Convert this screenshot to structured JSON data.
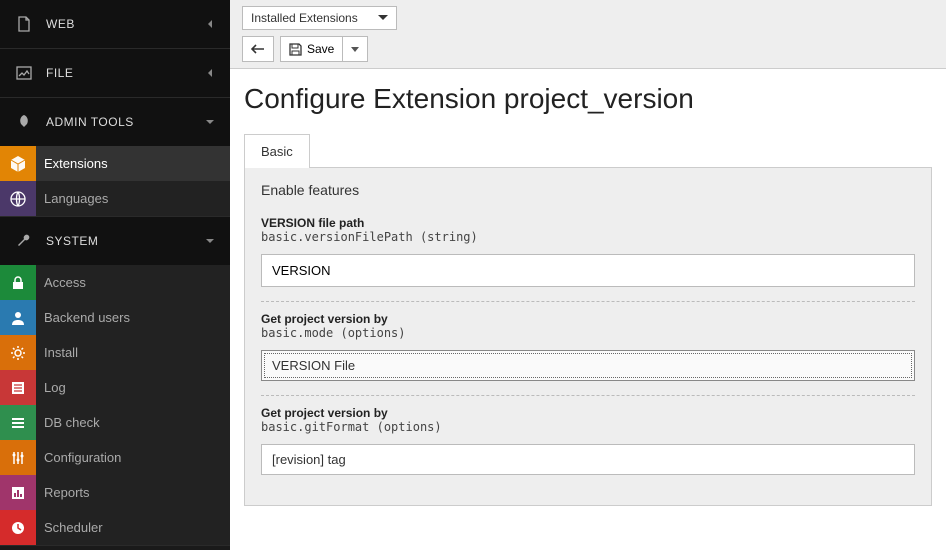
{
  "sidebar": {
    "groups": [
      {
        "label": "WEB",
        "expanded": false,
        "items": []
      },
      {
        "label": "FILE",
        "expanded": false,
        "items": []
      },
      {
        "label": "ADMIN TOOLS",
        "expanded": true,
        "items": [
          {
            "label": "Extensions",
            "icon": "box-icon",
            "color": "ic-orange",
            "active": true
          },
          {
            "label": "Languages",
            "icon": "globe-icon",
            "color": "ic-purple",
            "active": false
          }
        ]
      },
      {
        "label": "SYSTEM",
        "expanded": true,
        "items": [
          {
            "label": "Access",
            "icon": "lock-icon",
            "color": "ic-green",
            "active": false
          },
          {
            "label": "Backend users",
            "icon": "user-icon",
            "color": "ic-blue",
            "active": false
          },
          {
            "label": "Install",
            "icon": "gear-icon",
            "color": "ic-orange2",
            "active": false
          },
          {
            "label": "Log",
            "icon": "list-icon",
            "color": "ic-red",
            "active": false
          },
          {
            "label": "DB check",
            "icon": "bars-icon",
            "color": "ic-green2",
            "active": false
          },
          {
            "label": "Configuration",
            "icon": "sliders-icon",
            "color": "ic-orange2",
            "active": false
          },
          {
            "label": "Reports",
            "icon": "report-icon",
            "color": "ic-pink",
            "active": false
          },
          {
            "label": "Scheduler",
            "icon": "clock-icon",
            "color": "ic-red2",
            "active": false
          }
        ]
      }
    ]
  },
  "toolbar": {
    "dropdown_label": "Installed Extensions",
    "back_label": "",
    "save_label": "Save"
  },
  "page": {
    "title": "Configure Extension project_version",
    "tabs": [
      {
        "label": "Basic",
        "active": true
      }
    ],
    "section_heading": "Enable features",
    "fields": [
      {
        "label": "VERSION file path",
        "sub": "basic.versionFilePath (string)",
        "type": "text",
        "value": "VERSION"
      },
      {
        "label": "Get project version by",
        "sub": "basic.mode (options)",
        "type": "select",
        "value": "VERSION File"
      },
      {
        "label": "Get project version by",
        "sub": "basic.gitFormat (options)",
        "type": "select",
        "value": "[revision] tag"
      }
    ]
  }
}
